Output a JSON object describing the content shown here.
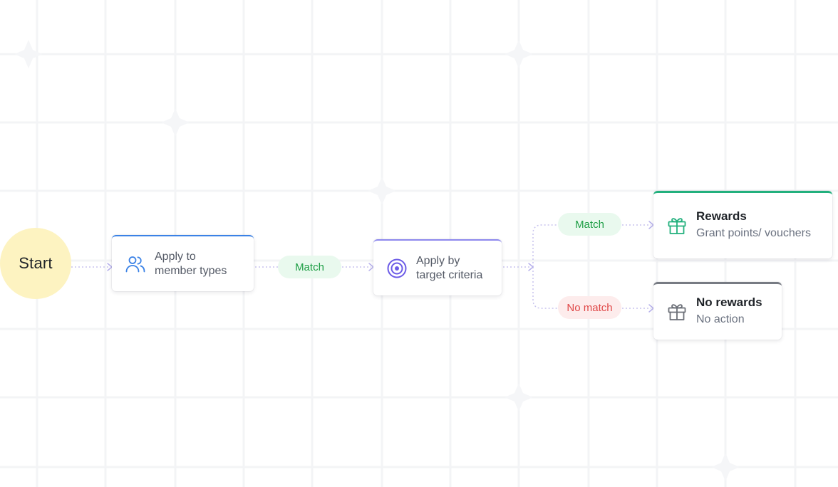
{
  "diagram": {
    "start": {
      "label": "Start"
    },
    "member_node": {
      "line1": "Apply to",
      "line2": "member types",
      "icon": "users-icon",
      "accent": "#3b82e6"
    },
    "target_node": {
      "line1": "Apply by",
      "line2": "target criteria",
      "icon": "target-icon",
      "accent": "#8d88ee"
    },
    "edges": {
      "match_1": "Match",
      "match_2": "Match",
      "no_match": "No match"
    },
    "rewards_node": {
      "title": "Rewards",
      "subtitle": "Grant points/ vouchers",
      "icon": "gift-icon",
      "accent": "#22b07d"
    },
    "no_rewards_node": {
      "title": "No rewards",
      "subtitle": "No action",
      "icon": "gift-icon",
      "accent": "#777b83"
    }
  },
  "colors": {
    "start_fill": "#fdf3c1",
    "match_bg": "#e9f9ee",
    "match_text": "#1e9e45",
    "nomatch_bg": "#fdecec",
    "nomatch_text": "#e04848",
    "connector": "#c8c4ee"
  }
}
